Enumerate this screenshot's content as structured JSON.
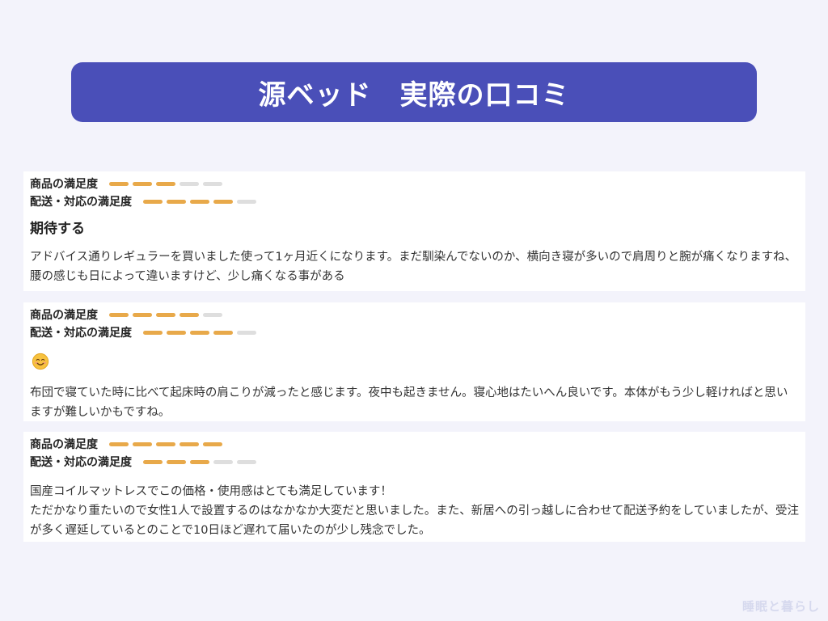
{
  "header": {
    "title": "源ベッド　実際の口コミ"
  },
  "labels": {
    "product": "商品の満足度",
    "delivery": "配送・対応の満足度"
  },
  "colors": {
    "banner": "#4a4fb8",
    "bar_active": "#e8a94a",
    "bar_inactive": "#dedede",
    "background": "#f3f3fb"
  },
  "reviews": [
    {
      "product_rating": 3,
      "delivery_rating": 4,
      "title": "期待する",
      "body": "アドバイス通りレギュラーを買いました使って1ヶ月近くになります。まだ馴染んでないのか、横向き寝が多いので肩周りと腕が痛くなりますね、腰の感じも日によって違いますけど、少し痛くなる事がある"
    },
    {
      "product_rating": 4,
      "delivery_rating": 4,
      "title_icon": "smiling-face-emoji",
      "body": "布団で寝ていた時に比べて起床時の肩こりが減ったと感じます。夜中も起きません。寝心地はたいへん良いです。本体がもう少し軽ければと思いますが難しいかもですね。"
    },
    {
      "product_rating": 5,
      "delivery_rating": 3,
      "body": "国産コイルマットレスでこの価格・使用感はとても満足しています！\nただかなり重たいので女性1人で設置するのはなかなか大変だと思いました。また、新居への引っ越しに合わせて配送予約をしていましたが、受注が多く遅延しているとのことで10日ほど遅れて届いたのが少し残念でした。"
    }
  ],
  "rating_max": 5,
  "watermark": "睡眠と暮らし"
}
